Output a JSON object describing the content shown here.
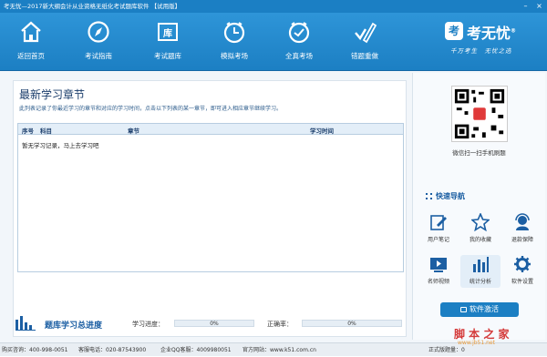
{
  "titlebar": {
    "title": "考无忧—2017新大纲会计从业资格无纸化考试题库软件 【试用版】"
  },
  "toolbar": {
    "items": [
      {
        "label": "返回首页",
        "icon": "home-icon"
      },
      {
        "label": "考试指南",
        "icon": "compass-icon"
      },
      {
        "label": "考试题库",
        "icon": "library-icon"
      },
      {
        "label": "模拟考场",
        "icon": "clock-icon"
      },
      {
        "label": "全真考场",
        "icon": "clock-icon"
      },
      {
        "label": "错题重做",
        "icon": "pencil-check-icon"
      }
    ],
    "library_glyph": "库"
  },
  "logo": {
    "mark": "考",
    "name": "考无忧",
    "reg": "®",
    "slogan": "千万考生　无忧之选"
  },
  "main": {
    "title": "最新学习章节",
    "description": "此列表记录了你最近学习的章节和对应的学习时间，点击以下列表的某一章节，即可进入相应章节继续学习。",
    "columns": [
      "序号",
      "科目",
      "章节",
      "学习时间"
    ],
    "empty_text": "暂无学习记录，马上去学习吧"
  },
  "stats": {
    "banner": "题库学习总进度",
    "progress_label": "学习进度：",
    "progress_value": "0%",
    "accuracy_label": "正确率：",
    "accuracy_value": "0%"
  },
  "side": {
    "qr_caption": "微信扫一扫手机刷题",
    "quick_nav": "快速导航",
    "items": [
      {
        "label": "用户笔记",
        "icon": "note-edit-icon"
      },
      {
        "label": "我的收藏",
        "icon": "star-icon"
      },
      {
        "label": "退款保障",
        "icon": "service-icon"
      },
      {
        "label": "名师视频",
        "icon": "video-icon"
      },
      {
        "label": "统计分析",
        "icon": "bar-chart-icon"
      },
      {
        "label": "软件设置",
        "icon": "gear-icon"
      }
    ],
    "activate": "软件激活"
  },
  "status": {
    "purchase": "购买咨询：400-998-0051",
    "service": "客服电话：020-87543900",
    "qq": "企业QQ客服：4009980051",
    "site": "官方网站：www.k51.com.cn",
    "version": "正式版题量：0"
  },
  "watermark": {
    "main": "脚 本 之 家",
    "sub": "www.jb51.net"
  },
  "colors": {
    "primary": "#1c7fc3",
    "toolbar_dark": "#1568a6"
  }
}
